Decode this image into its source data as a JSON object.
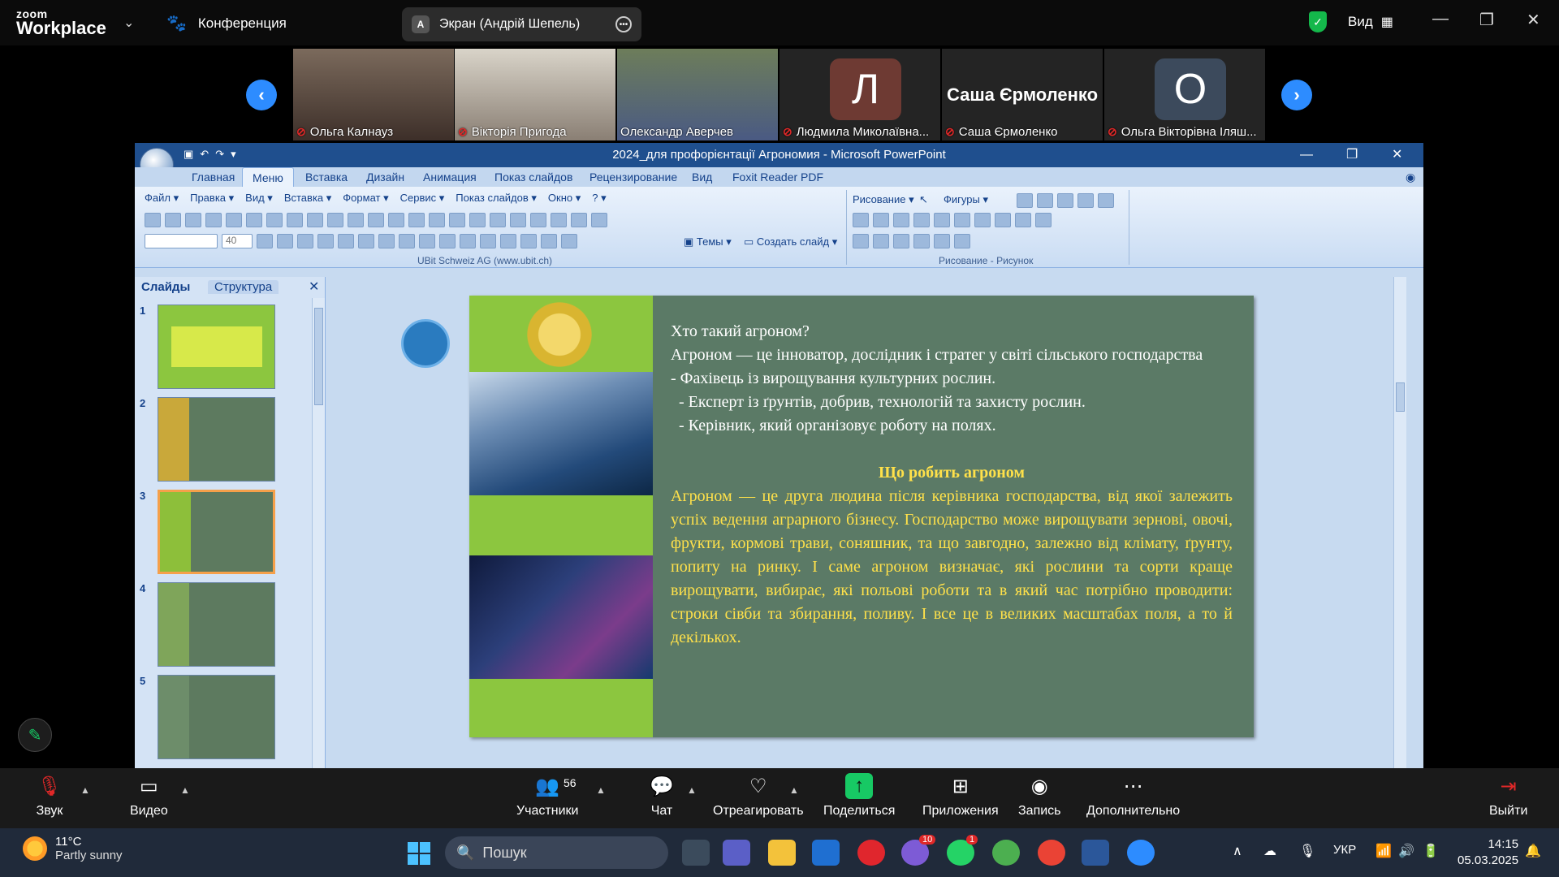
{
  "zoom_top": {
    "logo_small": "zoom",
    "logo_big": "Workplace",
    "conference_label": "Конференция",
    "screen_badge": "A",
    "screen_label": "Экран (Андрій Шепель)",
    "view_label": "Вид"
  },
  "participants": [
    {
      "name": "Ольга Калнауз"
    },
    {
      "name": "Вікторія Пригода"
    },
    {
      "name": "Олександр Аверчев"
    },
    {
      "name": "Людмила Миколаївна...",
      "avatar": "Л"
    },
    {
      "name": "Саша Єрмоленко",
      "display": "Саша Єрмоленко"
    },
    {
      "name": "Ольга Вікторівна Іляш...",
      "avatar": "О"
    }
  ],
  "ppt": {
    "title": "2024_для профорієнтації Агрономия - Microsoft PowerPoint",
    "tabs": [
      "Главная",
      "Меню",
      "Вставка",
      "Дизайн",
      "Анимация",
      "Показ слайдов",
      "Рецензирование",
      "Вид",
      "Foxit Reader PDF"
    ],
    "menu": [
      "Файл ▾",
      "Правка ▾",
      "Вид ▾",
      "Вставка ▾",
      "Формат ▾",
      "Сервис ▾",
      "Показ слайдов ▾",
      "Окно ▾",
      "? ▾"
    ],
    "font_size": "40",
    "themes_label": "Темы",
    "new_slide_label": "Создать слайд",
    "group_left": "UBit Schweiz AG    (www.ubit.ch)",
    "drawing_label": "Рисование",
    "shapes_label": "Фигуры",
    "group_right": "Рисование - Рисунок",
    "panel_tabs": [
      "Слайды",
      "Структура"
    ],
    "thumb_numbers": [
      "1",
      "2",
      "3",
      "4",
      "5"
    ],
    "slide": {
      "line1": "Хто такий агроном?",
      "line2": "Агроном — це інноватор, дослідник і стратег у світі сільського господарства",
      "line3": "- Фахівець із вирощування культурних рослин.",
      "line4": "- Експерт із ґрунтів, добрив, технологій та захисту рослин.",
      "line5": "- Керівник, який організовує роботу на полях.",
      "heading": "Що робить агроном",
      "paragraph": "Агроном — це друга людина після керівника господарства, від якої залежить успіх ведення аграрного бізнесу. Господарство може вирощувати зернові, овочі, фрукти, кормові трави, соняшник, та що завгодно, залежно від клімату, ґрунту, попиту на ринку. І саме агроном визначає, які рослини та сорти краще вирощувати, вибирає, які польові роботи та в який час потрібно проводити: строки сівби та збирання, поливу. І все це в великих масштабах поля, а то й декількох."
    }
  },
  "zoom_bottom": {
    "audio": "Звук",
    "video": "Видео",
    "participants": "Участники",
    "participants_count": "56",
    "chat": "Чат",
    "react": "Отреагировать",
    "share": "Поделиться",
    "apps": "Приложения",
    "record": "Запись",
    "more": "Дополнительно",
    "leave": "Выйти"
  },
  "taskbar": {
    "temp": "11°C",
    "weather": "Partly sunny",
    "search": "Пошук",
    "lang": "УКР",
    "time": "14:15",
    "date": "05.03.2025",
    "badge1": "10",
    "badge2": "1"
  },
  "colors": {
    "zoom_blue": "#2d8cff",
    "slide_bg": "#5b7a66",
    "slide_green": "#8cc63f",
    "slide_yellow": "#ffe14a",
    "ppt_title": "#1f4f8e"
  }
}
